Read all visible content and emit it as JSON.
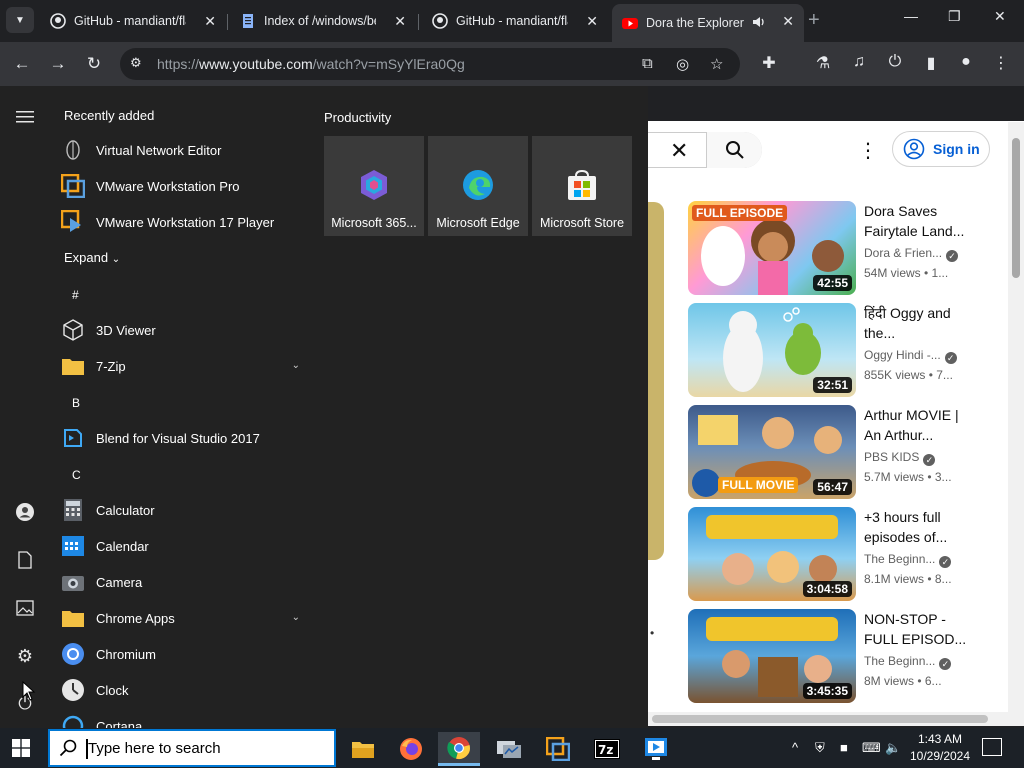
{
  "tabs": [
    {
      "label": "GitHub - mandiant/fla",
      "close": "✕"
    },
    {
      "label": "Index of /windows/be",
      "close": "✕"
    },
    {
      "label": "GitHub - mandiant/fla",
      "close": "✕"
    },
    {
      "label": "Dora the Explorer",
      "close": "✕"
    }
  ],
  "window": {
    "new_tab": "+",
    "minimize": "—",
    "restore": "❐",
    "close": "✕"
  },
  "address": {
    "scheme": "https://",
    "host": "www.youtube.com",
    "path": "/watch?v=mSyYlEra0Qg"
  },
  "youtube": {
    "signin": "Sign in",
    "recs": [
      {
        "title": "Dora Saves Fairytale Land...",
        "channel": "Dora & Frien...",
        "meta": "54M views • 1...",
        "duration": "42:55",
        "badge": "FULL EPISODE"
      },
      {
        "title": "हिंदी Oggy and the...",
        "channel": "Oggy Hindi -...",
        "meta": "855K views • 7...",
        "duration": "32:51",
        "badge": ""
      },
      {
        "title": "Arthur MOVIE | An Arthur...",
        "channel": "PBS KIDS",
        "meta": "5.7M views • 3...",
        "duration": "56:47",
        "badge": "FULL MOVIE"
      },
      {
        "title": "+3 hours full episodes of...",
        "channel": "The Beginn...",
        "meta": "8.1M views • 8...",
        "duration": "3:04:58",
        "badge": ""
      },
      {
        "title": "NON-STOP - FULL EPISOD...",
        "channel": "The Beginn...",
        "meta": "8M views • 6...",
        "duration": "3:45:35",
        "badge": ""
      }
    ]
  },
  "start": {
    "recently_added": "Recently added",
    "recent": [
      {
        "label": "Virtual Network Editor"
      },
      {
        "label": "VMware Workstation Pro"
      },
      {
        "label": "VMware Workstation 17 Player"
      }
    ],
    "expand": "Expand",
    "letters": {
      "hash": "#",
      "b": "B",
      "c": "C"
    },
    "apps_hash": [
      {
        "label": "3D Viewer"
      },
      {
        "label": "7-Zip"
      }
    ],
    "apps_b": [
      {
        "label": "Blend for Visual Studio 2017"
      }
    ],
    "apps_c": [
      {
        "label": "Calculator"
      },
      {
        "label": "Calendar"
      },
      {
        "label": "Camera"
      },
      {
        "label": "Chrome Apps"
      },
      {
        "label": "Chromium"
      },
      {
        "label": "Clock"
      },
      {
        "label": "Cortana"
      }
    ],
    "productivity": "Productivity",
    "tiles": [
      {
        "label": "Microsoft 365..."
      },
      {
        "label": "Microsoft Edge"
      },
      {
        "label": "Microsoft Store"
      }
    ]
  },
  "taskbar": {
    "search_placeholder": "Type here to search",
    "time": "1:43 AM",
    "date": "10/29/2024"
  },
  "colors": {
    "accent": "#0078d4",
    "youtube_red": "#ff0000",
    "signin_blue": "#065fd4"
  }
}
